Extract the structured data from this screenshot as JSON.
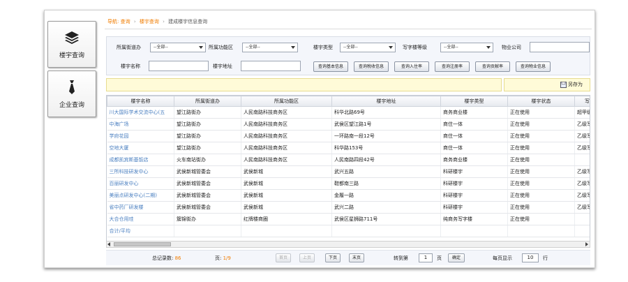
{
  "sidebar": {
    "items": [
      {
        "label": "楼宇查询",
        "icon": "layers-icon"
      },
      {
        "label": "企业查询",
        "icon": "tie-icon"
      }
    ]
  },
  "breadcrumb": {
    "prefix": "导航:",
    "items": [
      "查询",
      "楼宇查询"
    ],
    "current": "建成楼宇信息查询",
    "sep": "›"
  },
  "filters": {
    "street_label": "所属街道办",
    "street_value": "--全部--",
    "zone_label": "所属功能区",
    "zone_value": "--全部--",
    "type_label": "楼宇类型",
    "type_value": "--全部--",
    "grade_label": "写字楼等级",
    "grade_value": "--全部--",
    "property_label": "物业公司",
    "name_label": "楼宇名称",
    "address_label": "楼宇地址",
    "buttons": [
      "查询基本信息",
      "查询税收信息",
      "查询入住率",
      "查询注册率",
      "查询贡献率",
      "查询物业信息"
    ]
  },
  "toolbar": {
    "save_as": "另存为",
    "save_icon": "save-icon"
  },
  "table": {
    "headers": [
      "楼宇名称",
      "所属街道办",
      "所属功能区",
      "楼宇地址",
      "楼宇类型",
      "楼宇状态",
      "写字楼"
    ],
    "rows": [
      [
        "川大国际学术交流中心(五",
        "望江路街办",
        "人民南路科技商务区",
        "科华北路69号",
        "商务商业楼",
        "正在使用",
        "超甲级写字楼"
      ],
      [
        "中海广场",
        "望江路街办",
        "人民南路科技商务区",
        "武侯区望江路1号",
        "商住一体",
        "正在使用",
        "乙级写字楼"
      ],
      [
        "学府花园",
        "望江路街办",
        "人民南路科技商务区",
        "一环路南一段12号",
        "商住一体",
        "正在使用",
        "乙级写字楼"
      ],
      [
        "空地大厦",
        "望江路街办",
        "人民南路科技商务区",
        "科华路153号",
        "商住一体",
        "正在使用",
        "乙级写字楼"
      ],
      [
        "成都凯宾斯基饭店",
        "火车南站街办",
        "人民南路科技商务区",
        "人民南路四段42号",
        "商务商业楼",
        "正在使用",
        ""
      ],
      [
        "三所科技研发中心",
        "武侯新城管委会",
        "武侯新城",
        "武兴五路",
        "科研楼宇",
        "正在使用",
        "乙级写字楼"
      ],
      [
        "百丽研发中心",
        "武侯新城管委会",
        "武侯新城",
        "鞋都南三路",
        "科研楼宇",
        "正在使用",
        "乙级写字楼"
      ],
      [
        "美丽点研发中心(二期)",
        "武侯新城管委会",
        "武侯新城",
        "金履一路",
        "科研楼宇",
        "正在使用",
        "乙级写字楼"
      ],
      [
        "省中药厂研发楼",
        "武侯新城管委会",
        "武侯新城",
        "武兴二路",
        "科研楼宇",
        "正在使用",
        "乙级写字楼"
      ],
      [
        "大合仓用珪",
        "簇锦街办",
        "红牌楼商圈",
        "武侯区星狮路711号",
        "纯商务写字楼",
        "正在使用",
        ""
      ]
    ],
    "total_label": "合计/平均"
  },
  "pager": {
    "total_label": "总记录数:",
    "total_value": "86",
    "page_label": "页:",
    "page_value": "1/9",
    "first": "首页",
    "prev": "上页",
    "next": "下页",
    "last": "末页",
    "goto_label": "转到第",
    "goto_value": "1",
    "goto_unit": "页",
    "confirm": "确定",
    "per_page_label": "每页显示",
    "per_page_value": "10",
    "per_page_unit": "行"
  },
  "colors": {
    "accent": "#f07c00",
    "link": "#4a7fc0",
    "notice": "#fffbd8"
  }
}
